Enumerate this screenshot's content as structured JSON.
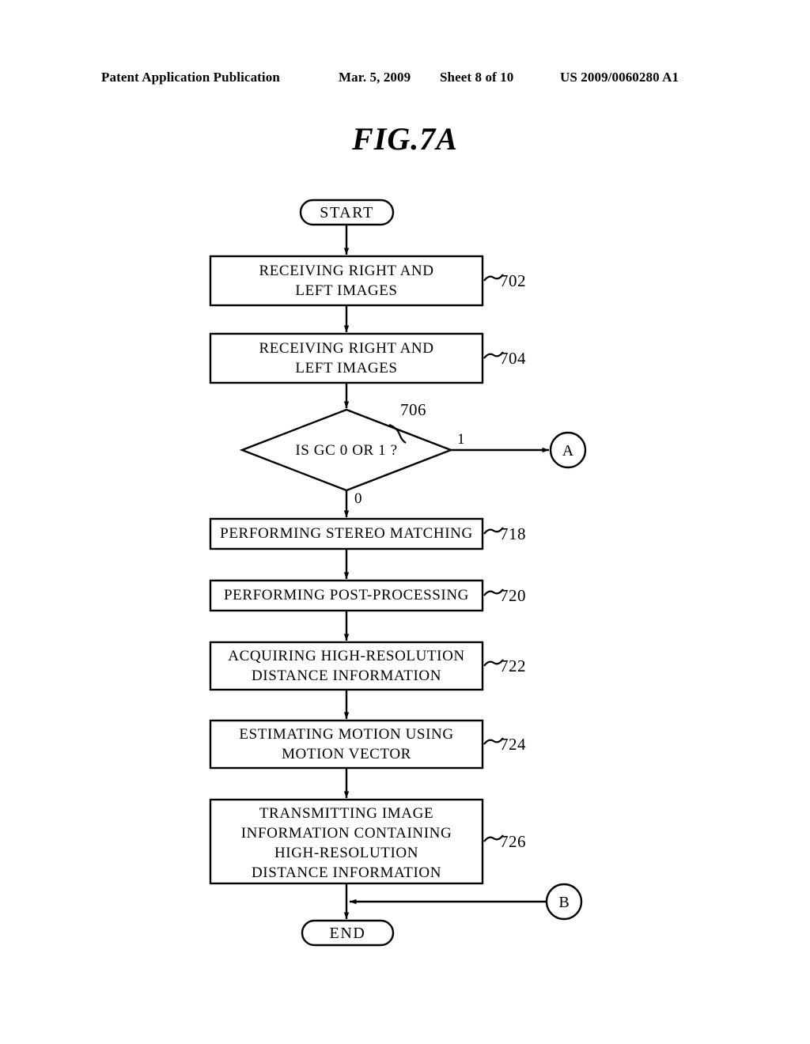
{
  "header": {
    "publication": "Patent Application Publication",
    "date": "Mar. 5, 2009",
    "sheet": "Sheet 8 of 10",
    "patent_number": "US 2009/0060280 A1"
  },
  "figure": {
    "title": "FIG.7A"
  },
  "flowchart": {
    "start_label": "START",
    "end_label": "END",
    "nodes": [
      {
        "id": "702",
        "text": "RECEIVING RIGHT AND\nLEFT IMAGES",
        "ref": "702"
      },
      {
        "id": "704",
        "text": "RECEIVING RIGHT AND\nLEFT IMAGES",
        "ref": "704"
      },
      {
        "id": "706",
        "text": "IS GC 0 OR 1 ?",
        "ref": "706"
      },
      {
        "id": "718",
        "text": "PERFORMING STEREO MATCHING",
        "ref": "718"
      },
      {
        "id": "720",
        "text": "PERFORMING POST-PROCESSING",
        "ref": "720"
      },
      {
        "id": "722",
        "text": "ACQUIRING HIGH-RESOLUTION\nDISTANCE INFORMATION",
        "ref": "722"
      },
      {
        "id": "724",
        "text": "ESTIMATING MOTION USING\nMOTION VECTOR",
        "ref": "724"
      },
      {
        "id": "726",
        "text": "TRANSMITTING IMAGE\nINFORMATION CONTAINING\nHIGH-RESOLUTION\nDISTANCE INFORMATION",
        "ref": "726"
      }
    ],
    "edge_labels": {
      "decision_yes": "1",
      "decision_no": "0"
    },
    "connectors": [
      {
        "id": "A",
        "label": "A"
      },
      {
        "id": "B",
        "label": "B"
      }
    ],
    "colors": {
      "line": "#000000",
      "background": "#ffffff"
    }
  }
}
